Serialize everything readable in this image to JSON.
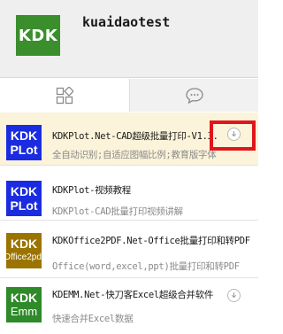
{
  "header": {
    "logo_text": "KDK",
    "user_name": "kuaidaotest"
  },
  "tabs": [
    {
      "id": "apps",
      "icon": "apps-grid-icon",
      "selected": true
    },
    {
      "id": "chat",
      "icon": "chat-bubble-icon",
      "selected": false
    }
  ],
  "colors": {
    "logo_green": "#3a8f2c",
    "icon_blue": "#1b2ce0",
    "icon_brown": "#9b7400",
    "icon_green": "#2f8a2a",
    "active_row": "#fbf3da",
    "highlight": "#e0161b"
  },
  "items": [
    {
      "icon_line1": "KDK",
      "icon_line2": "PLot",
      "title": "KDKPlot.Net-CAD超级批量打印-V1.3.",
      "description": "全自动识别;自适应图幅比例;教育版字体",
      "has_download": true,
      "highlighted": true
    },
    {
      "icon_line1": "KDK",
      "icon_line2": "PLot",
      "title": "KDKPlot-视频教程",
      "description": "KDKPlot-CAD批量打印视频讲解",
      "has_download": false
    },
    {
      "icon_line1": "KDK",
      "icon_line2": "Office2pdf",
      "title": "KDKOffice2PDF.Net-Office批量打印和转PDF",
      "description": "Office(word,excel,ppt)批量打印和转PDF",
      "has_download": false
    },
    {
      "icon_line1": "KDK",
      "icon_line2": "Emm",
      "title": "KDEMM.Net-快刀客Excel超级合并软件",
      "description": "快速合并Excel数据",
      "has_download": true
    }
  ]
}
